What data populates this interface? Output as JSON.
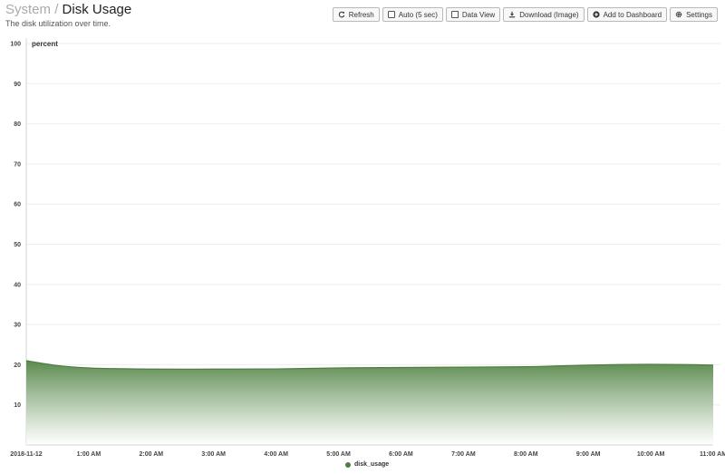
{
  "header": {
    "breadcrumb_parent": "System",
    "separator": "/",
    "title": "Disk Usage",
    "subtitle": "The disk utilization over time."
  },
  "toolbar": {
    "refresh": "Refresh",
    "auto": "Auto (5 sec)",
    "data_view": "Data View",
    "download": "Download (Image)",
    "add_dashboard": "Add to Dashboard",
    "settings": "Settings"
  },
  "colors": {
    "series": "#4e7d3f",
    "fill_top": "#5b8a4e",
    "fill_bottom": "#ffffff"
  },
  "chart_data": {
    "type": "area",
    "ylabel": "percent",
    "ylim": [
      0,
      100
    ],
    "yticks": [
      10,
      20,
      30,
      40,
      50,
      60,
      70,
      80,
      90,
      100
    ],
    "x_labels": [
      "2018-11-12",
      "1:00 AM",
      "2:00 AM",
      "3:00 AM",
      "4:00 AM",
      "5:00 AM",
      "6:00 AM",
      "7:00 AM",
      "8:00 AM",
      "9:00 AM",
      "10:00 AM",
      "11:00 AM"
    ],
    "x_hours": [
      0,
      0.5,
      1,
      1.5,
      2,
      3,
      4,
      5,
      6,
      7,
      8,
      8.5,
      9,
      9.5,
      10,
      10.5,
      11
    ],
    "series": [
      {
        "name": "disk_usage",
        "values": [
          21.0,
          19.8,
          19.2,
          19.0,
          18.9,
          18.9,
          18.95,
          19.2,
          19.3,
          19.4,
          19.5,
          19.7,
          19.9,
          20.05,
          20.1,
          20.05,
          19.9
        ]
      }
    ],
    "legend_position": "bottom-center",
    "grid": true
  }
}
